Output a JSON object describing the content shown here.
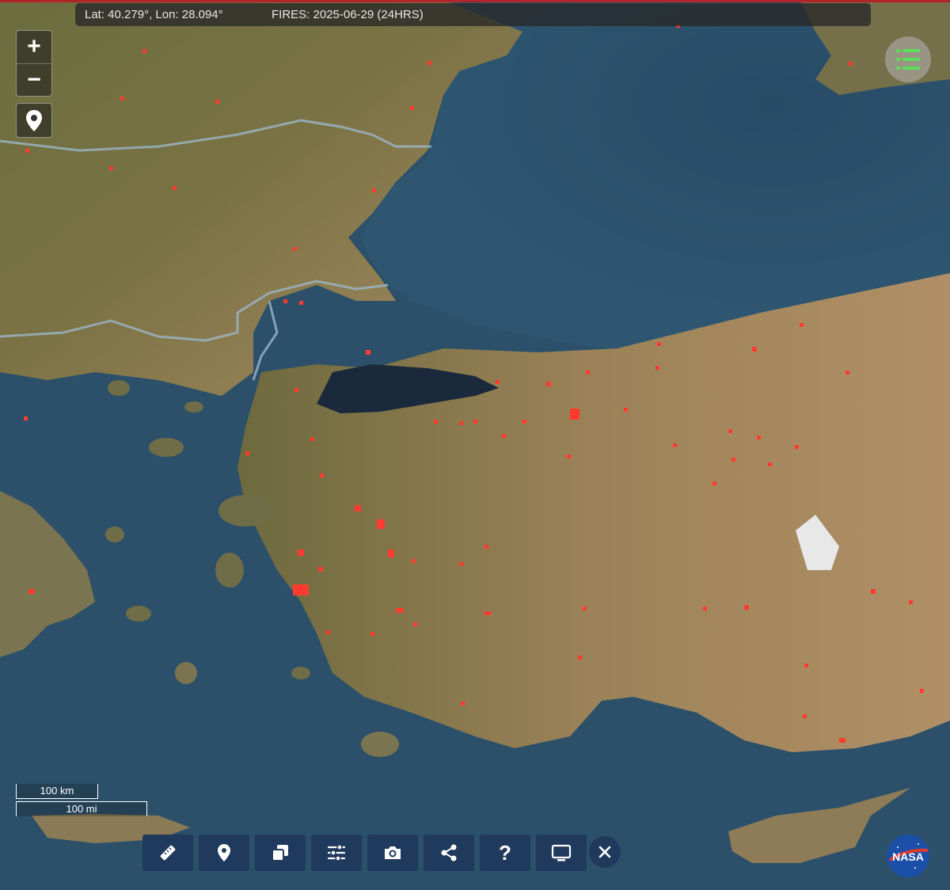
{
  "status": {
    "coordinates": "Lat: 40.279°, Lon: 28.094°",
    "fires_label": "FIRES: 2025-06-29 (24HRS)"
  },
  "zoom": {
    "in_label": "+",
    "out_label": "−"
  },
  "scale": {
    "km_label": "100 km",
    "mi_label": "100 mi"
  },
  "toolbar": {
    "icons": [
      "ruler-icon",
      "map-pin-icon",
      "copy-icon",
      "sliders-icon",
      "camera-icon",
      "share-icon",
      "help-icon",
      "monitor-icon",
      "close-icon"
    ],
    "help_glyph": "?"
  },
  "logo": {
    "text": "NASA"
  },
  "colors": {
    "sea": "#2c4f66",
    "land_dark": "#5a6a3c",
    "land_light": "#a58c62",
    "fire": "#ff3b30",
    "toolbar": "#1f3a5c",
    "layers_icon": "#5adf5a"
  }
}
